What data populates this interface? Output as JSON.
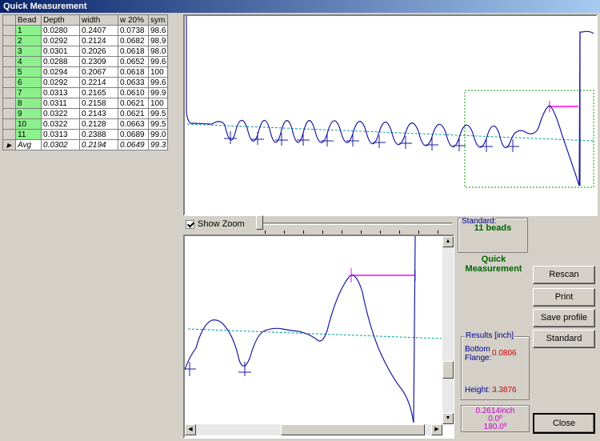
{
  "window": {
    "title": "Quick Measurement"
  },
  "grid": {
    "headers": [
      "Bead",
      "Depth",
      "width",
      "w 20%",
      "sym"
    ],
    "rows": [
      [
        "1",
        "0.0280",
        "0.2407",
        "0.0738",
        "98.6"
      ],
      [
        "2",
        "0.0292",
        "0.2124",
        "0.0682",
        "98.9"
      ],
      [
        "3",
        "0.0301",
        "0.2026",
        "0.0618",
        "98.0"
      ],
      [
        "4",
        "0.0288",
        "0.2309",
        "0.0652",
        "99.6"
      ],
      [
        "5",
        "0.0294",
        "0.2067",
        "0.0618",
        "100"
      ],
      [
        "6",
        "0.0292",
        "0.2214",
        "0.0633",
        "99.6"
      ],
      [
        "7",
        "0.0313",
        "0.2165",
        "0.0610",
        "99.9"
      ],
      [
        "8",
        "0.0311",
        "0.2158",
        "0.0621",
        "100"
      ],
      [
        "9",
        "0.0322",
        "0.2143",
        "0.0621",
        "99.5"
      ],
      [
        "10",
        "0.0322",
        "0.2128",
        "0.0663",
        "99.5"
      ],
      [
        "11",
        "0.0313",
        "0.2388",
        "0.0689",
        "99.0"
      ]
    ],
    "avg": [
      "Avg",
      "0.0302",
      "0.2194",
      "0.0649",
      "99.3"
    ]
  },
  "zoom": {
    "checkbox_label": "Show Zoom",
    "checked": true
  },
  "standard": {
    "label": "Standard:",
    "value": "11 beads"
  },
  "mode_label": "Quick Measurement",
  "buttons": {
    "rescan": "Rescan",
    "print": "Print",
    "save_profile": "Save profile",
    "standard": "Standard",
    "close": "Close"
  },
  "results": {
    "title": "Results [inch]",
    "bottom_flange_label": "Bottom Flange:",
    "bottom_flange_value": "0.0806",
    "height_label": "Height:",
    "height_value": "3.3876"
  },
  "readout": {
    "line1": "0.2614inch",
    "line2": "0.0º",
    "line3": "180.0º"
  },
  "colors": {
    "profile": "#1a1aa0",
    "baseline": "#00a0a0",
    "highlight": "#ff00ff",
    "zoom_box": "#00a000",
    "bead_cell": "#8cf08c"
  }
}
